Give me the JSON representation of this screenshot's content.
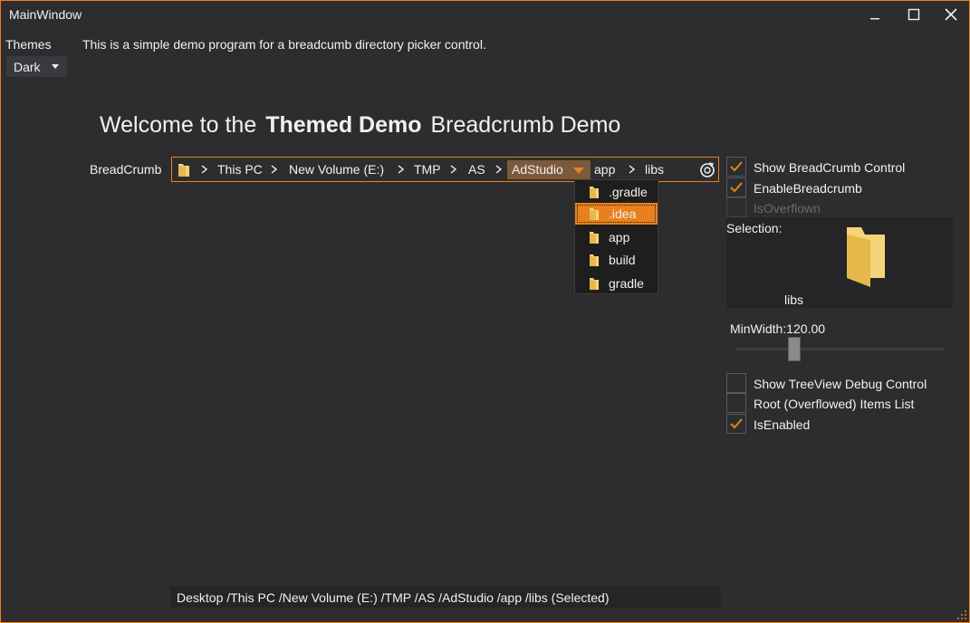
{
  "window": {
    "title": "MainWindow"
  },
  "themes": {
    "label": "Themes",
    "selected": "Dark"
  },
  "description": "This is a simple demo program for a breadcumb directory picker control.",
  "welcome": {
    "prefix": "Welcome to the",
    "bold": "Themed Demo",
    "suffix": "Breadcrumb Demo"
  },
  "breadcrumb": {
    "label": "BreadCrumb",
    "items": [
      "This PC",
      "New Volume (E:)",
      "TMP",
      "AS",
      "AdStudio",
      "app",
      "libs"
    ],
    "active_item": "AdStudio"
  },
  "dropdown": {
    "items": [
      ".gradle",
      ".idea",
      "app",
      "build",
      "gradle"
    ],
    "selected": ".idea"
  },
  "options": {
    "show_breadcrumb": {
      "label": "Show BreadCrumb Control",
      "checked": true
    },
    "enable_breadcrumb": {
      "label": "EnableBreadcrumb",
      "checked": true
    },
    "is_overflown": {
      "label": "IsOverflown",
      "checked": false
    },
    "show_treeview": {
      "label": "Show TreeView Debug Control",
      "checked": false
    },
    "root_items": {
      "label": "Root (Overflowed) Items List",
      "checked": false
    },
    "is_enabled": {
      "label": "IsEnabled",
      "checked": true
    }
  },
  "selection": {
    "label": "Selection:",
    "name": "libs"
  },
  "min_width": {
    "label": "MinWidth:120.00",
    "value": 120.0
  },
  "status": {
    "path": "Desktop /This PC /New Volume (E:) /TMP /AS /AdStudio /app /libs (Selected)"
  },
  "colors": {
    "accent": "#e8811d",
    "background": "#2d2d30",
    "folder": "#f5d47a"
  }
}
